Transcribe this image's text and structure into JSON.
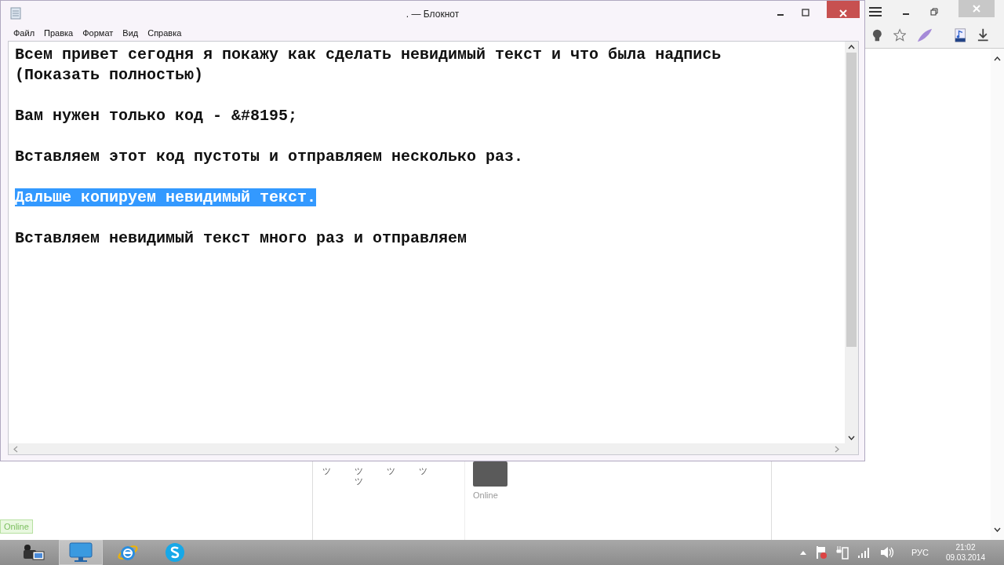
{
  "notepad": {
    "title": ". — Блокнот",
    "menu": [
      "Файл",
      "Правка",
      "Формат",
      "Вид",
      "Справка"
    ],
    "paragraphs": [
      {
        "text": "Всем привет сегодня я покажу как сделать невидимый текст и что была надпись (Показать полностью)",
        "selected": false
      },
      {
        "text": "Вам нужен только код - &#8195;",
        "selected": false
      },
      {
        "text": "Вставляем этот код пустоты и отправляем несколько раз.",
        "selected": false
      },
      {
        "text": "Дальше копируем невидимый текст.",
        "selected": true
      },
      {
        "text": "Вставляем невидимый текст много раз и отправляем",
        "selected": false
      }
    ]
  },
  "browser_page": {
    "smileys": [
      [
        "ツ"
      ],
      [
        "ツ",
        "ツ"
      ],
      [
        "ツ"
      ],
      [
        "ツ"
      ]
    ],
    "status": "Online",
    "badge": "Online"
  },
  "taskbar": {
    "apps": [
      {
        "kind": "camera",
        "active": false
      },
      {
        "kind": "monitor",
        "active": true
      },
      {
        "kind": "ie",
        "active": false
      },
      {
        "kind": "skype",
        "active": false
      }
    ],
    "language": "РУС",
    "time": "21:02",
    "date": "09.03.2014"
  }
}
